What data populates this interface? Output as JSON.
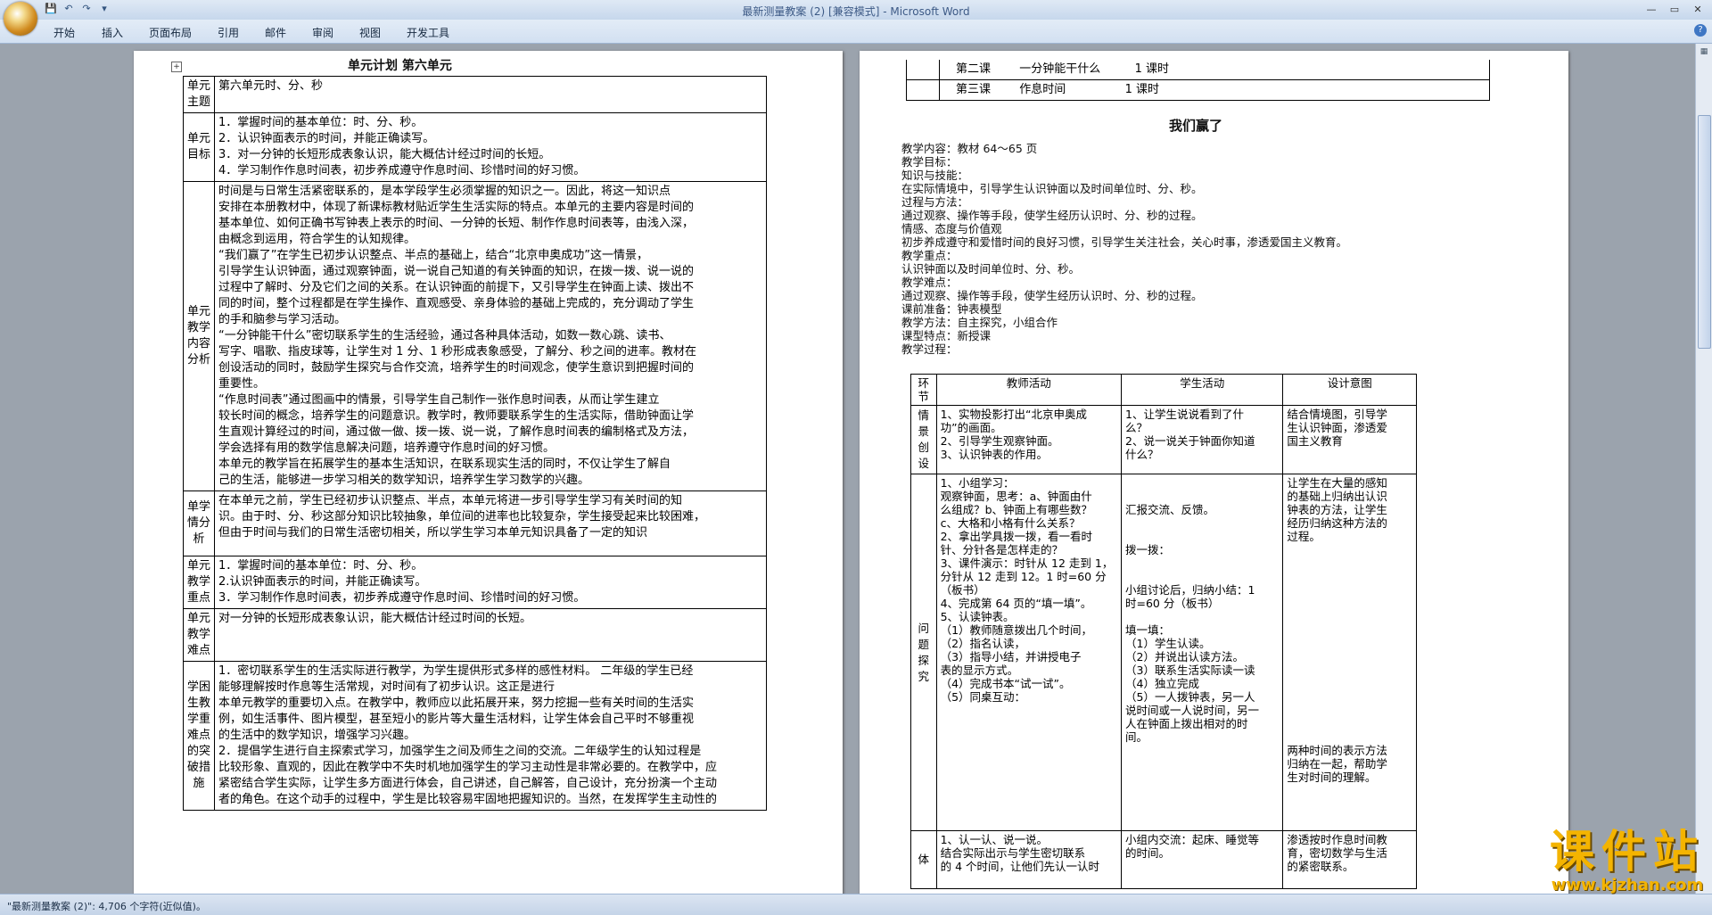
{
  "window": {
    "title": "最新测量教案 (2) [兼容模式] - Microsoft Word",
    "controls": [
      "—",
      "▭",
      "✕"
    ]
  },
  "qat": [
    "save-icon",
    "undo-icon",
    "redo-icon",
    "customize-icon"
  ],
  "tabs": [
    "开始",
    "插入",
    "页面布局",
    "引用",
    "邮件",
    "审阅",
    "视图",
    "开发工具"
  ],
  "status": {
    "text": "\"最新测量教案 (2)\": 4,706 个字符(近似值)。"
  },
  "watermark": {
    "title": "课件站",
    "url": "www.kjzhan.com"
  },
  "page1": {
    "title": "单元计划    第六单元",
    "rows": [
      {
        "label": "单元主题",
        "lines": [
          "第六单元时、分、秒"
        ]
      },
      {
        "label": "单元目标",
        "lines": [
          "1．掌握时间的基本单位：时、分、秒。",
          "2．认识钟面表示的时间，并能正确读写。",
          "3．对一分钟的长短形成表象认识，能大概估计经过时间的长短。",
          "4．学习制作作息时间表，初步养成遵守作息时间、珍惜时间的好习惯。"
        ]
      },
      {
        "label": "单元教学内容分析",
        "lines": [
          "时间是与日常生活紧密联系的，是本学段学生必须掌握的知识之一。因此，将这一知识点",
          "安排在本册教材中，体现了新课标教材贴近学生生活实际的特点。本单元的主要内容是时间的",
          "基本单位、如何正确书写钟表上表示的时间、一分钟的长短、制作作息时间表等，由浅入深，",
          "由概念到运用，符合学生的认知规律。",
          "“我们赢了”在学生已初步认识整点、半点的基础上，结合“北京申奥成功”这一情景，",
          "引导学生认识钟面，通过观察钟面，说一说自己知道的有关钟面的知识，在拨一拨、说一说的",
          "过程中了解时、分及它们之间的关系。在认识钟面的前提下，又引导学生在钟面上读、拨出不",
          "同的时间，整个过程都是在学生操作、直观感受、亲身体验的基础上完成的，充分调动了学生",
          "的手和脑参与学习活动。",
          "“一分钟能干什么”密切联系学生的生活经验，通过各种具体活动，如数一数心跳、读书、",
          "写字、唱歌、指皮球等，让学生对 1 分、1 秒形成表象感受，了解分、秒之间的进率。教材在",
          "创设活动的同时，鼓励学生探究与合作交流，培养学生的时间观念，使学生意识到把握时间的",
          "重要性。",
          "“作息时间表”通过图画中的情景，引导学生自己制作一张作息时间表，从而让学生建立",
          "较长时间的概念，培养学生的问题意识。教学时，教师要联系学生的生活实际，借助钟面让学",
          "生直观计算经过的时间，通过做一做、拨一拨、说一说，了解作息时间表的编制格式及方法，",
          "学会选择有用的数学信息解决问题，培养遵守作息时间的好习惯。",
          "本单元的教学旨在拓展学生的基本生活知识，在联系现实生活的同时，不仅让学生了解自",
          "己的生活，能够进一步学习相关的数学知识，培养学生学习数学的兴趣。"
        ]
      },
      {
        "label": "单学情分析",
        "lines": [
          "在本单元之前，学生已经初步认识整点、半点，本单元将进一步引导学生学习有关时间的知",
          "识。由于时、分、秒这部分知识比较抽象，单位间的进率也比较复杂，学生接受起来比较困难，",
          "但由于时间与我们的日常生活密切相关，所以学生学习本单元知识具备了一定的知识"
        ]
      },
      {
        "label": "单元教学重点",
        "lines": [
          "1．掌握时间的基本单位：时、分、秒。",
          "2.认识钟面表示的时间，并能正确读写。",
          "3．学习制作作息时间表，初步养成遵守作息时间、珍惜时间的好习惯。"
        ]
      },
      {
        "label": "单元教学难点",
        "lines": [
          "对一分钟的长短形成表象认识，能大概估计经过时间的长短。"
        ]
      },
      {
        "label": "学困生教学重难点的突破措施",
        "lines": [
          "1．密切联系学生的生活实际进行教学，为学生提供形式多样的感性材料。 二年级的学生已经",
          "能够理解按时作息等生活常规，对时间有了初步认识。这正是进行",
          "本单元教学的重要切入点。在教学中，教师应以此拓展开来，努力挖掘一些有关时间的生活实",
          "例，如生活事件、图片模型，甚至短小的影片等大量生活材料，让学生体会自己平时不够重视",
          "的生活中的数学知识，增强学习兴趣。",
          "2．提倡学生进行自主探索式学习，加强学生之间及师生之间的交流。二年级学生的认知过程是",
          "比较形象、直观的，因此在教学中不失时机地加强学生的学习主动性是非常必要的。在教学中，应",
          "紧密结合学生实际，让学生多方面进行体会，自己讲述，自己解答，自己设计，充分扮演一个主动",
          "者的角色。在这个动手的过程中，学生是比较容易牢固地把握知识的。当然，在发挥学生主动性的"
        ]
      }
    ]
  },
  "page2": {
    "top_rows": [
      {
        "lesson": "第二课",
        "name": "一分钟能干什么",
        "hours": "1 课时"
      },
      {
        "lesson": "第三课",
        "name": "作息时间",
        "hours": "1 课时"
      }
    ],
    "heading": "我们赢了",
    "lines": [
      "教学内容：教材 64～65 页",
      "教学目标：",
      "知识与技能：",
      "    在实际情境中，引导学生认识钟面以及时间单位时、分、秒。",
      "过程与方法：",
      "    通过观察、操作等手段，使学生经历认识时、分、秒的过程。",
      "情感、态度与价值观",
      "   初步养成遵守和爱惜时间的良好习惯，引导学生关注社会，关心时事，渗透爱国主义教育。",
      "教学重点：",
      "    认识钟面以及时间单位时、分、秒。",
      "教学难点：",
      "    通过观察、操作等手段，使学生经历认识时、分、秒的过程。",
      "课前准备：钟表模型",
      "教学方法：自主探究，小组合作",
      "课型特点：新授课",
      "教学过程："
    ],
    "process_table": {
      "headers": [
        "环节",
        "教师活动",
        "学生活动",
        "设计意图"
      ],
      "rows": [
        {
          "stage": "情景创设",
          "teacher": [
            "1、实物投影打出“北京申奥成",
            "   功”的画面。",
            "2、引导学生观察钟面。",
            "3、认识钟表的作用。"
          ],
          "student": [
            "1、让学生说说看到了什",
            "么？",
            "2、说一说关于钟面你知道",
            "什么？"
          ],
          "intent": [
            "结合情境图，引导学",
            "生认识钟面，渗透爱",
            "国主义教育"
          ]
        },
        {
          "stage": "问题探究",
          "teacher": [
            "1、小组学习：",
            "观察钟面，思考：a、钟面由什",
            "么组成？b、钟面上有哪些数？",
            "c、大格和小格有什么关系？",
            "2、拿出学具拨一拨，看一看时",
            "   针、分针各是怎样走的？",
            "3、课件演示：时针从 12 走到 1，",
            "分针从 12 走到 12。1 时=60 分",
            "（板书）",
            "4、完成第 64 页的“填一填”。",
            "5、认读钟表。",
            "   （1）教师随意拨出几个时间，",
            "   （2）指名认读，",
            "   （3）指导小结，并讲授电子",
            "表的显示方式。",
            "   （4）完成书本“试一试”。",
            "   （5）同桌互动："
          ],
          "student": [
            "",
            "",
            "汇报交流、反馈。",
            "",
            "",
            "拨一拨：",
            "",
            "",
            "小组讨论后，归纳小结：1",
            "时=60 分（板书）",
            "",
            "填一填：",
            "（1）学生认读。",
            "（2）并说出认读方法。",
            "（3）联系生活实际读一读",
            "（4）独立完成",
            "（5）一人拨钟表，另一人",
            "说时间或一人说时间，另一",
            "人在钟面上拨出相对的时",
            "间。"
          ],
          "intent": [
            "让学生在大量的感知",
            "的基础上归纳出认识",
            "钟表的方法，让学生",
            "经历归纳这种方法的",
            "过程。",
            "",
            "",
            "",
            "",
            "",
            "",
            "",
            "",
            "",
            "",
            "",
            "",
            "",
            "",
            "",
            "两种时间的表示方法",
            "归纳在一起，帮助学",
            "生对时间的理解。"
          ]
        },
        {
          "stage": "体",
          "teacher": [
            "1、认一认、说一说。",
            "结合实际出示与学生密切联系",
            "的 4 个时间，让他们先认一认时"
          ],
          "student": [
            "小组内交流：起床、睡觉等",
            "的时间。"
          ],
          "intent": [
            "渗透按时作息时间教",
            "育，密切数学与生活",
            "的紧密联系。"
          ]
        }
      ]
    }
  }
}
